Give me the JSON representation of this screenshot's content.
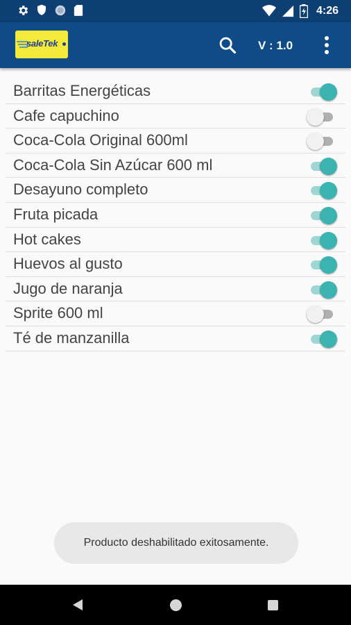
{
  "status_bar": {
    "time": "4:26",
    "left_icons": [
      "gear-icon",
      "shield-icon",
      "circle-icon",
      "sd-card-icon"
    ],
    "right_icons": [
      "wifi-icon",
      "signal-icon",
      "battery-icon"
    ]
  },
  "app_bar": {
    "logo_text": "saleTek",
    "version_label": "V : 1.0",
    "icons": [
      "search-icon",
      "more-vert-icon"
    ]
  },
  "products": [
    {
      "name": "Barritas Energéticas",
      "enabled": true
    },
    {
      "name": "Cafe capuchino",
      "enabled": false
    },
    {
      "name": "Coca-Cola Original 600ml",
      "enabled": false
    },
    {
      "name": "Coca-Cola Sin Azúcar 600 ml",
      "enabled": true
    },
    {
      "name": "Desayuno completo",
      "enabled": true
    },
    {
      "name": "Fruta picada",
      "enabled": true
    },
    {
      "name": "Hot cakes",
      "enabled": true
    },
    {
      "name": "Huevos al gusto",
      "enabled": true
    },
    {
      "name": "Jugo de naranja",
      "enabled": true
    },
    {
      "name": "Sprite 600 ml",
      "enabled": false
    },
    {
      "name": "Té de manzanilla",
      "enabled": true
    }
  ],
  "toast": {
    "message": "Producto deshabilitado exitosamente."
  },
  "colors": {
    "app_bar": "#0f4c87",
    "switch_on": "#3bb3b1",
    "logo_bg": "#f4ea3a"
  },
  "nav_bar": {
    "icons": [
      "back-icon",
      "home-icon",
      "recents-icon"
    ]
  }
}
